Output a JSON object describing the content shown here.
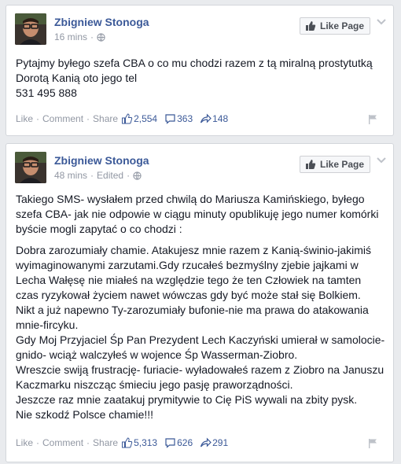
{
  "posts": [
    {
      "author": "Zbigniew Stonoga",
      "time": "16 mins",
      "edited": "",
      "like_page_label": "Like Page",
      "paragraphs": [
        "Pytajmy byłego szefa CBA o co mu chodzi razem z tą miralną prostytutką Dorotą Kanią oto jego tel",
        "531 495 888"
      ],
      "actions": {
        "like": "Like",
        "comment": "Comment",
        "share": "Share"
      },
      "counts": {
        "likes": "2,554",
        "comments": "363",
        "shares": "148"
      }
    },
    {
      "author": "Zbigniew Stonoga",
      "time": "48 mins",
      "edited": "Edited",
      "like_page_label": "Like Page",
      "paragraphs": [
        "Takiego SMS- wysłałem przed chwilą do Mariusza Kamińskiego, byłego szefa CBA- jak nie odpowie w ciągu minuty opublikuję jego numer komórki byście mogli zapytać o co chodzi :",
        "Dobra zarozumiały chamie. Atakujesz mnie razem z Kanią-świnio-jakimiś wyimaginowanymi zarzutami.Gdy rzucałeś bezmyślny zjebie jajkami w Lecha Wałęsę nie miałeś na względzie tego że ten Człowiek na tamten czas ryzykował życiem nawet wówczas gdy być może stał się Bolkiem.",
        "Nikt a już napewno Ty-zarozumiały bufonie-nie ma prawa do atakowania mnie-fircyku.",
        "Gdy Moj Przyjaciel Śp Pan Prezydent Lech Kaczyński umierał w samolocie-gnido- wciąż walczyłeś w wojence Śp Wasserman-Ziobro.",
        "Wreszcie swiją frustrację- furiacie- wyładowałeś razem z Ziobro na Januszu Kaczmarku niszcząc śmieciu jego pasję praworządności.",
        "Jeszcze raz mnie zaatakuj prymitywie to Cię PiS wywali na zbity pysk.",
        "Nie szkodź Polsce chamie!!!"
      ],
      "actions": {
        "like": "Like",
        "comment": "Comment",
        "share": "Share"
      },
      "counts": {
        "likes": "5,313",
        "comments": "626",
        "shares": "291"
      }
    }
  ],
  "colors": {
    "link_blue": "#3b5998",
    "meta_gray": "#9197a3",
    "background": "#e9ebee"
  }
}
